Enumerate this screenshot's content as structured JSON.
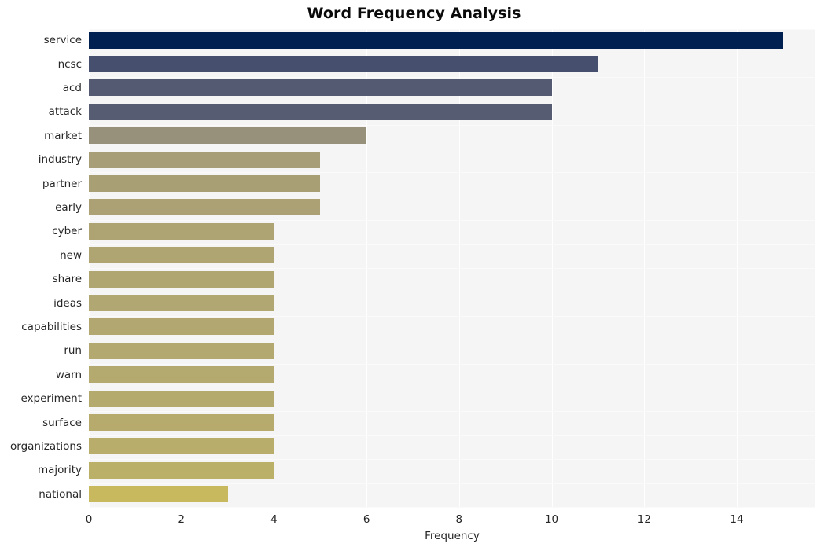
{
  "chart_data": {
    "type": "bar",
    "orientation": "horizontal",
    "title": "Word Frequency Analysis",
    "xlabel": "Frequency",
    "ylabel": "",
    "categories": [
      "service",
      "ncsc",
      "acd",
      "attack",
      "market",
      "industry",
      "partner",
      "early",
      "cyber",
      "new",
      "share",
      "ideas",
      "capabilities",
      "run",
      "warn",
      "experiment",
      "surface",
      "organizations",
      "majority",
      "national"
    ],
    "values": [
      15,
      11,
      10,
      10,
      6,
      5,
      5,
      5,
      4,
      4,
      4,
      4,
      4,
      4,
      4,
      4,
      4,
      4,
      4,
      3
    ],
    "bar_colors": [
      "#002051",
      "#46506e",
      "#545a71",
      "#565c72",
      "#97917b",
      "#a79d76",
      "#a99f75",
      "#aba175",
      "#aea473",
      "#afa573",
      "#b0a672",
      "#b1a772",
      "#b2a671",
      "#b3a870",
      "#b4a96f",
      "#b5aa6e",
      "#b6ab6d",
      "#b8ad6b",
      "#bbb068",
      "#c8b85e"
    ],
    "xlim": [
      0,
      15.7
    ],
    "xticks": [
      0,
      2,
      4,
      6,
      8,
      10,
      12,
      14
    ],
    "xtick_labels": [
      "0",
      "2",
      "4",
      "6",
      "8",
      "10",
      "12",
      "14"
    ],
    "grid": true,
    "grid_axis": "x",
    "legend": false,
    "plot_background": "#f5f5f5",
    "figure_background": "#ffffff",
    "title_color": "#0a0a0a",
    "tick_color": "#262626"
  }
}
